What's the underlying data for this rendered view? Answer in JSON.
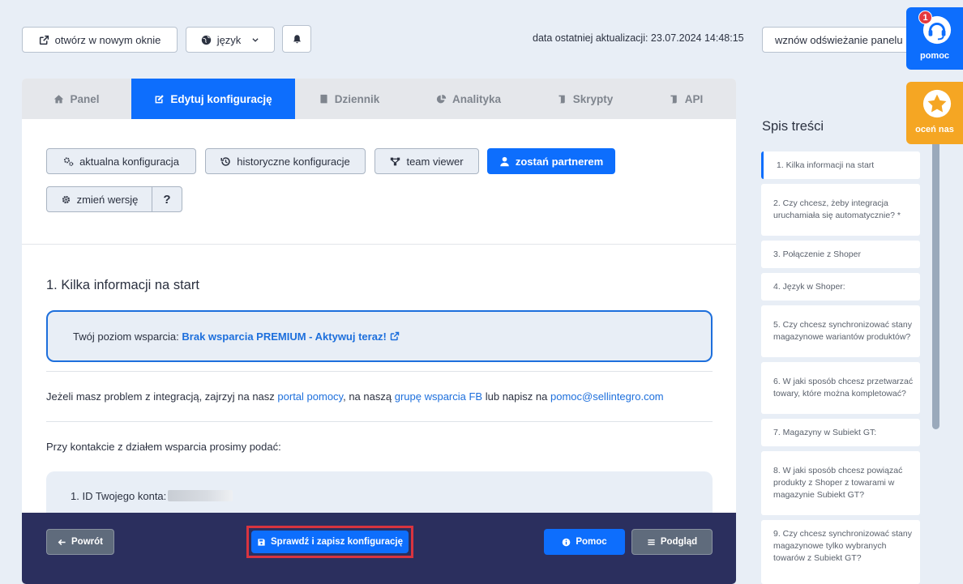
{
  "topbar": {
    "open_new_window": "otwórz w nowym oknie",
    "language": "język",
    "last_update": "data ostatniej aktualizacji: 23.07.2024 14:48:15",
    "resume_refresh": "wznów odświeżanie panelu"
  },
  "tabs": [
    {
      "label": "Panel",
      "icon": "home-icon"
    },
    {
      "label": "Edytuj konfigurację",
      "icon": "edit-icon",
      "active": true
    },
    {
      "label": "Dziennik",
      "icon": "book-icon"
    },
    {
      "label": "Analityka",
      "icon": "pie-chart-icon"
    },
    {
      "label": "Skrypty",
      "icon": "scroll-icon"
    },
    {
      "label": "API",
      "icon": "scroll-icon"
    }
  ],
  "subnav": {
    "current_config": "aktualna konfiguracja",
    "historical_config": "historyczne konfiguracje",
    "team_viewer": "team viewer",
    "become_partner": "zostań partnerem",
    "change_version": "zmień wersję",
    "help_q": "?"
  },
  "section": {
    "title": "1. Kilka informacji na start",
    "support_level_label": "Twój poziom wsparcia:",
    "support_level_link": "Brak wsparcia PREMIUM - Aktywuj teraz!",
    "problem_text_1": "Jeżeli masz problem z integracją, zajrzyj na nasz",
    "portal_link": "portal pomocy",
    "problem_text_2": ", na naszą",
    "fb_link": "grupę wsparcia FB",
    "problem_text_3": "lub napisz na",
    "email_link": "pomoc@sellintegro.com",
    "contact_text": "Przy kontakcie z działem wsparcia prosimy podać:",
    "list_item_1": "1. ID Twojego konta:"
  },
  "bottom_bar": {
    "back": "Powrót",
    "save": "Sprawdź i zapisz konfigurację",
    "help": "Pomoc",
    "preview": "Podgląd"
  },
  "toc": {
    "title": "Spis treści",
    "items": [
      "1. Kilka informacji na start",
      "2. Czy chcesz, żeby integracja uruchamiała się automatycznie? *",
      "3. Połączenie z Shoper",
      "4. Język w Shoper:",
      "5. Czy chcesz synchronizować stany magazynowe wariantów produktów?",
      "6. W jaki sposób chcesz przetwarzać towary, które można kompletować?",
      "7. Magazyny w Subiekt GT:",
      "8. W jaki sposób chcesz powiązać produkty z Shoper z towarami w magazynie Subiekt GT?",
      "9. Czy chcesz synchronizować stany magazynowe tylko wybranych towarów z Subiekt GT?"
    ]
  },
  "widgets": {
    "help_label": "pomoc",
    "help_badge": "1",
    "rate_label": "oceń nas"
  },
  "colors": {
    "primary": "#0d6efd",
    "navy": "#2b2f5e",
    "orange": "#f5a623",
    "highlight_red": "#d9343f"
  }
}
